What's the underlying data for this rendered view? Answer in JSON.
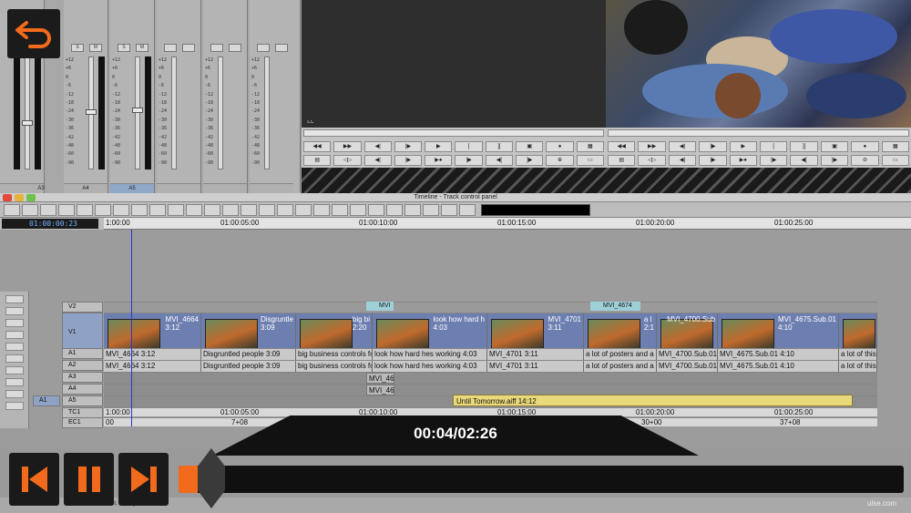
{
  "colors": {
    "accent": "#f26a1b",
    "playhead": "#2a36d8",
    "video_clip": "#6d7fb0",
    "audio_fx_clip": "#e9d97a",
    "timecode_text": "#78b2ff"
  },
  "mixer": {
    "tracks": [
      "A3",
      "A4",
      "A5"
    ],
    "selected_track": "A5",
    "scale": [
      "+12",
      "+6",
      "0",
      "-6",
      "-12",
      "-18",
      "-24",
      "-30",
      "-36",
      "-42",
      "-48",
      "-60",
      "-90"
    ],
    "solo_label": "S",
    "mute_label": "M"
  },
  "overlay": {
    "back_icon": "undo-arrow-icon",
    "time_display": "00:04/02:26",
    "progress": 0.027,
    "buttons": [
      "skip-back-icon",
      "pause-icon",
      "skip-forward-icon"
    ]
  },
  "timeline": {
    "window_title": "Timeline - Track control panel",
    "current_timecode": "01:00:00:23",
    "ruler": [
      "1:00:00",
      "01:00:05:00",
      "01:00:10:00",
      "01:00:15:00",
      "01:00:20:00",
      "01:00:25:00"
    ],
    "tracks": {
      "v2": "V2",
      "v1": "V1",
      "a1": "A1",
      "a2": "A2",
      "a3": "A3",
      "a4": "A4",
      "a5": "A5",
      "tc1": "TC1",
      "ec1": "EC1",
      "a5_patch": "A1"
    },
    "v2_clips": [
      "MVI",
      "MVI_4674"
    ],
    "video_clips": [
      {
        "name": "MVI_4664",
        "dur": "3:12"
      },
      {
        "name": "Disgruntle",
        "dur": "3:09"
      },
      {
        "name": "big bi",
        "dur": "2:20"
      },
      {
        "name": "look how hard h",
        "dur": "4:03"
      },
      {
        "name": "MVI_4701",
        "dur": "3:11"
      },
      {
        "name": "a l",
        "dur": "2:1"
      },
      {
        "name": "MVI_4700.Sub",
        "dur": ""
      },
      {
        "name": "MVI_4675.Sub.01",
        "dur": "4:10"
      },
      {
        "name": "",
        "dur": ""
      }
    ],
    "audio_clips": [
      "MVI_4664 3:12",
      "Disgruntled people 3:09",
      "big business controls fo",
      "look how hard hes working 4:03",
      "MVI_4701 3:11",
      "a lot of posters and a",
      "MVI_4700.Sub.01 3:11",
      "MVI_4675.Sub.01 4:10",
      "a lot of this"
    ],
    "a3_clip": "MVI_46",
    "a4_clip": "MVI_46",
    "a5_clip": "Until Tomorrow.aiff 14:12",
    "tc_labels": [
      "1:00:00",
      "01:00:05:00",
      "01:00:10:00",
      "01:00:15:00",
      "01:00:20:00",
      "01:00:25:00"
    ],
    "ec_labels": [
      "00",
      "7+08",
      "30+00",
      "37+08"
    ],
    "status_text": "Bit. Editing bus: C",
    "watermark": "ulse.com"
  }
}
